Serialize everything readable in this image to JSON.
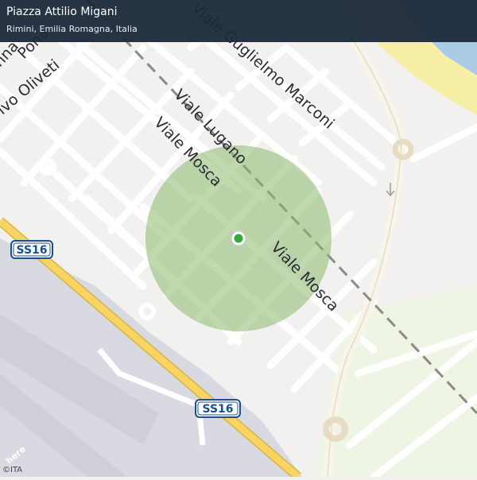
{
  "header": {
    "title": "Piazza Attilio Migani",
    "subtitle": "Rimini, Emilia Romagna, Italia"
  },
  "map": {
    "street_labels": {
      "viale_guglielmo_marconi": "Viale Guglielmo Marconi",
      "viale_lugano": "Viale Lugano",
      "viale_mosca_upper": "Viale Mosca",
      "viale_mosca_lower": "Viale Mosca",
      "salvo_oliveti": "lvo Oliveti",
      "partial_top_left_1": "Pona",
      "partial_top_left_2": "nna"
    },
    "road_shields": {
      "ss16_left": "SS16",
      "ss16_bottom": "SS16"
    },
    "location_marker": {
      "color": "#35a83a"
    },
    "accuracy_circle": {
      "color": "#8cb86b"
    },
    "colors": {
      "sea": "#a9cbe6",
      "beach": "#f7efa6",
      "park": "#eef5e4",
      "highway_fill": "#f7d463",
      "railway": "#8a8a8a",
      "airport": "#d9d9e2"
    }
  },
  "attribution": {
    "logo": "here",
    "copyright": "©ITA"
  }
}
